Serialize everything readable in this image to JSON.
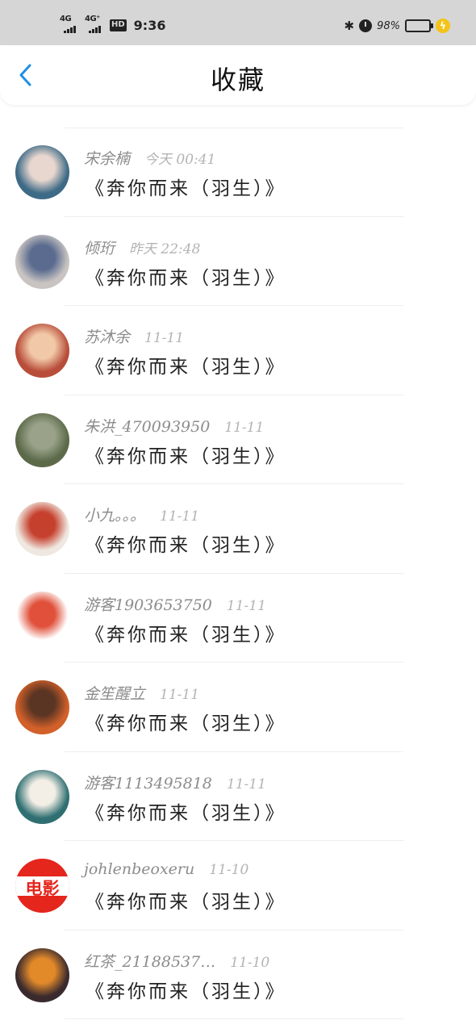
{
  "status_bar": {
    "net1": "4G",
    "net2": "4G⁺",
    "hd": "HD",
    "time": "9:36",
    "bluetooth_icon": "bluetooth-icon",
    "alarm_icon": "alarm-icon",
    "battery_percent": "98%",
    "battery_level": 0.98,
    "battery_color": "#3cd44b",
    "charge_color": "#f3c318"
  },
  "nav": {
    "back_icon": "chevron-left-icon",
    "accent": "#1e90e6",
    "title": "收藏"
  },
  "items": [
    {
      "name": "宋余楠",
      "time": "今天 00:41",
      "content": "《奔你而来（羽生）》",
      "avatar": {
        "bg": "#3d6a86",
        "fg": "#e8d7cf"
      }
    },
    {
      "name": "倾珩",
      "time": "昨天 22:48",
      "content": "《奔你而来（羽生）》",
      "avatar": {
        "bg": "#c9c4c2",
        "fg": "#5a6b8f"
      }
    },
    {
      "name": "苏沐余",
      "time": "11-11",
      "content": "《奔你而来（羽生）》",
      "avatar": {
        "bg": "#b84d3a",
        "fg": "#f2c9a8"
      }
    },
    {
      "name": "朱洪_470093950",
      "time": "11-11",
      "content": "《奔你而来（羽生）》",
      "avatar": {
        "bg": "#5d6a4a",
        "fg": "#9aa38a"
      }
    },
    {
      "name": "小九。。。",
      "time": "11-11",
      "content": "《奔你而来（羽生）》",
      "avatar": {
        "bg": "#efe8e0",
        "fg": "#c6402e"
      }
    },
    {
      "name": "游客1903653750",
      "time": "11-11",
      "content": "《奔你而来（羽生）》",
      "avatar": {
        "bg": "#ffffff",
        "fg": "#e0503a"
      }
    },
    {
      "name": "金笙醒立",
      "time": "11-11",
      "content": "《奔你而来（羽生）》",
      "avatar": {
        "bg": "#d2602a",
        "fg": "#5b3523"
      }
    },
    {
      "name": "游客1113495818",
      "time": "11-11",
      "content": "《奔你而来（羽生）》",
      "avatar": {
        "bg": "#2f6f72",
        "fg": "#f4efe6"
      }
    },
    {
      "name": "johlenbeoxeru",
      "time": "11-10",
      "content": "《奔你而来（羽生）》",
      "avatar": {
        "bg": "#e4261d",
        "fg": "#f7b233",
        "text": "电影"
      }
    },
    {
      "name": "红茶_21188537…",
      "time": "11-10",
      "content": "《奔你而来（羽生）》",
      "avatar": {
        "bg": "#3a2a2e",
        "fg": "#e28a2a"
      }
    }
  ]
}
